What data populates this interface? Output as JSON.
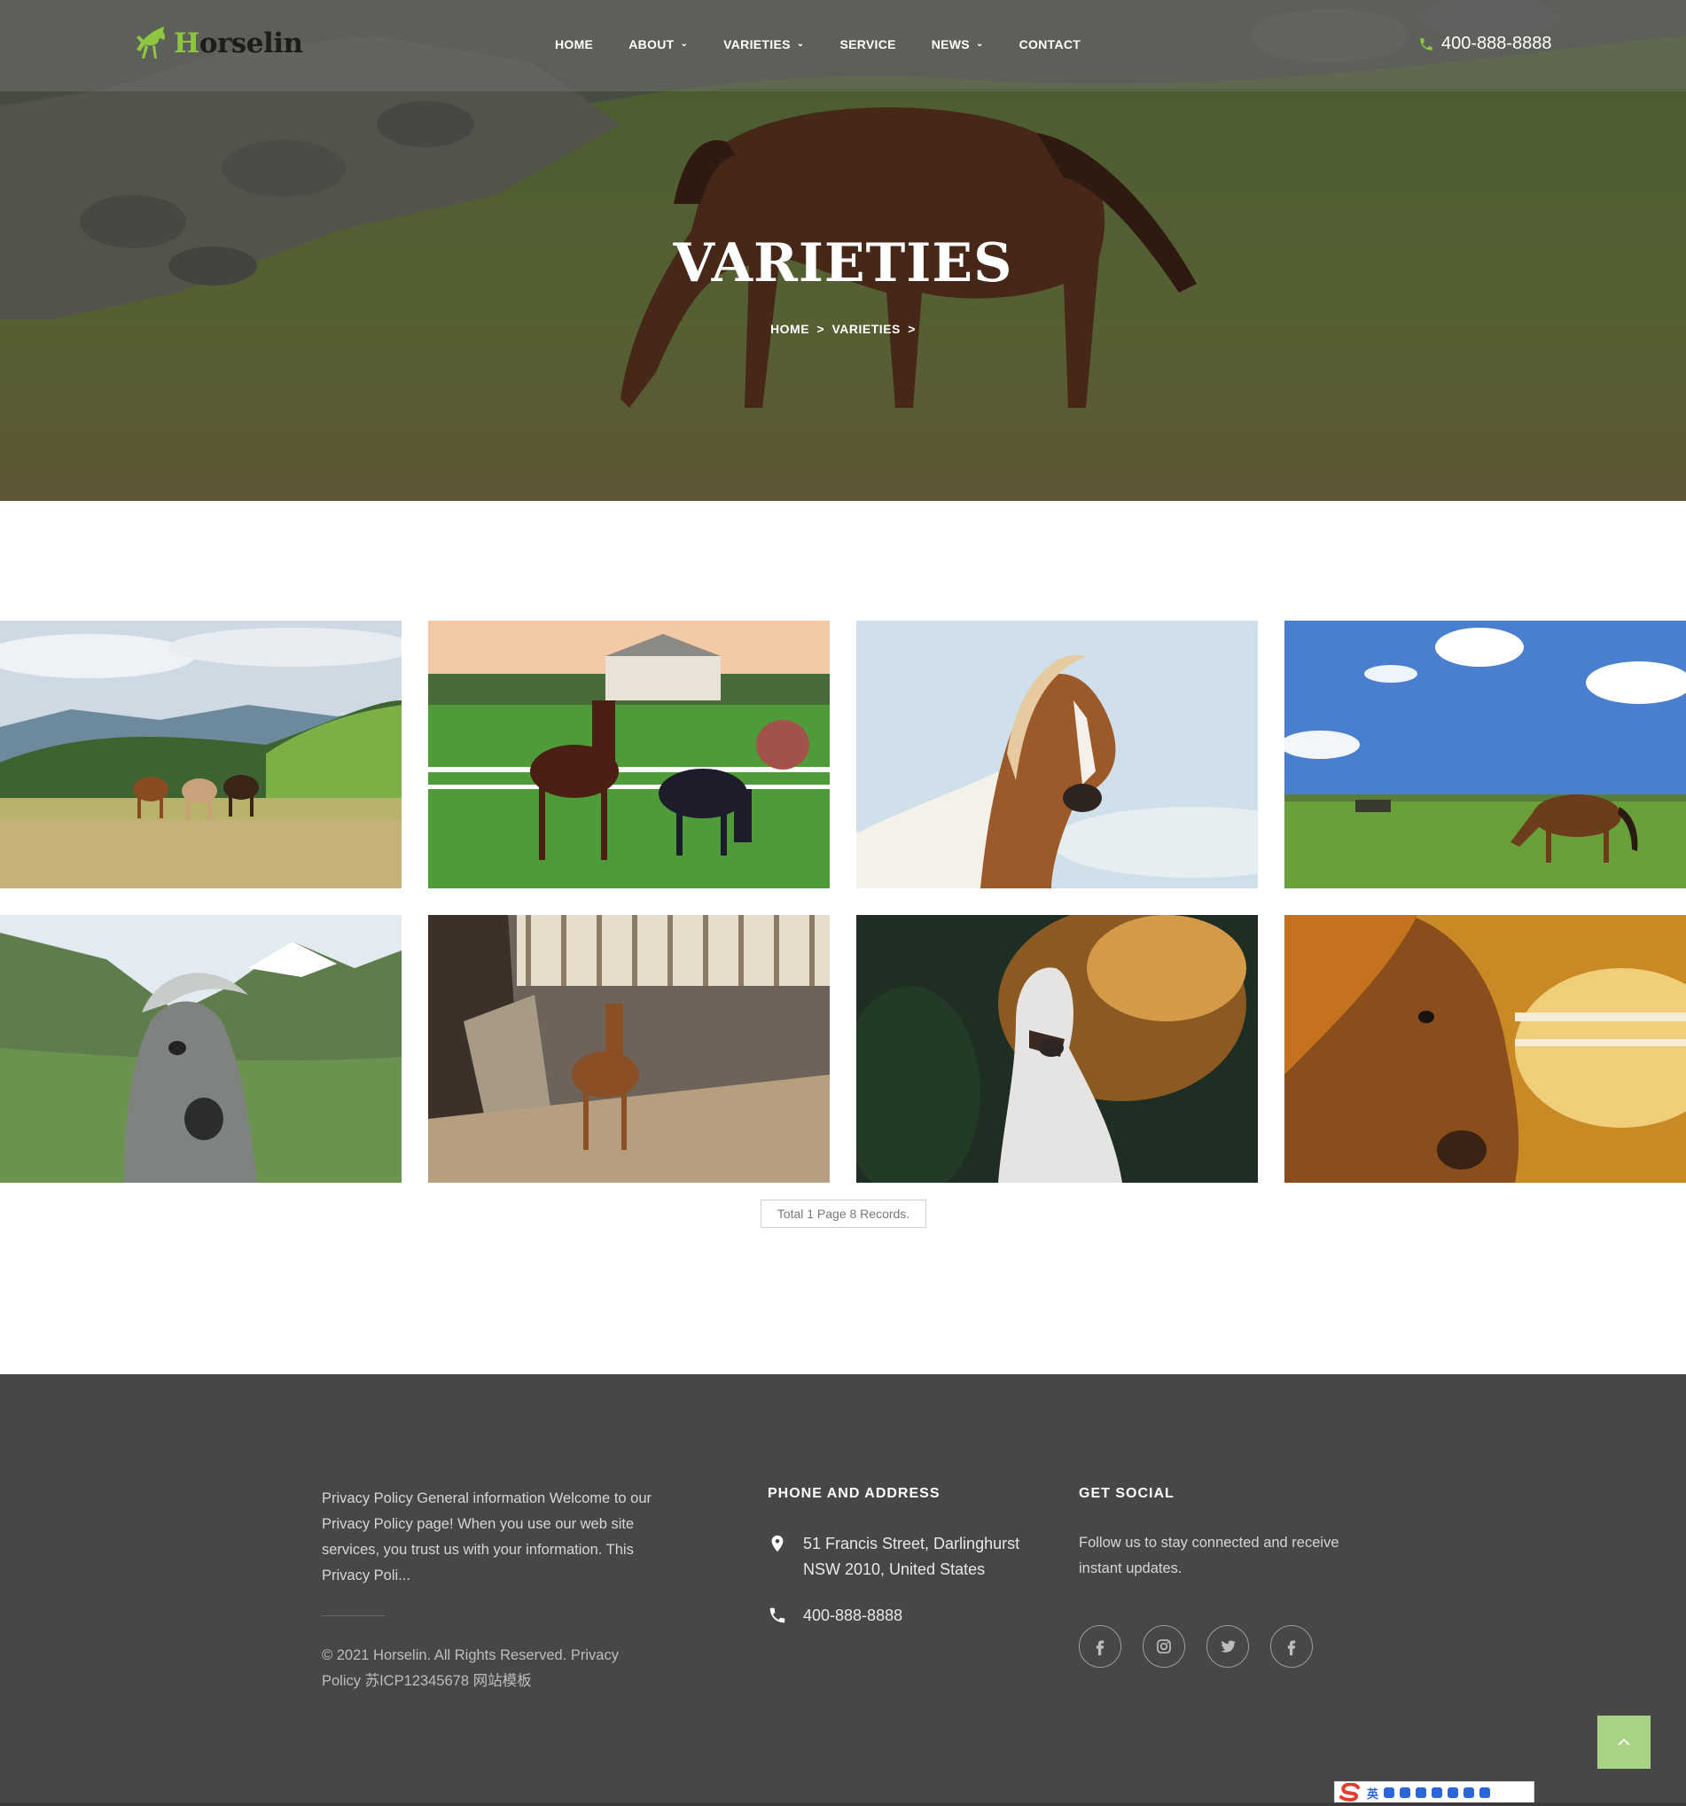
{
  "brand": {
    "name_first_letter": "H",
    "name_rest": "orselin",
    "accent": "#8ec63f"
  },
  "nav": {
    "items": [
      {
        "label": "HOME",
        "dropdown": false
      },
      {
        "label": "ABOUT",
        "dropdown": true
      },
      {
        "label": "VARIETIES",
        "dropdown": true
      },
      {
        "label": "SERVICE",
        "dropdown": false
      },
      {
        "label": "NEWS",
        "dropdown": true
      },
      {
        "label": "CONTACT",
        "dropdown": false
      }
    ],
    "phone": "400-888-8888",
    "icons": {
      "phone": "phone-icon",
      "dropdown": "chevron-down-icon"
    }
  },
  "hero": {
    "title": "VARIETIES",
    "breadcrumb": [
      "HOME",
      ">",
      "VARIETIES",
      ">"
    ]
  },
  "gallery": {
    "images": [
      "horses-in-mountain-meadow",
      "horses-on-ranch-pasture",
      "pinto-horse-portrait-sky",
      "horse-grazing-open-field",
      "grey-pony-in-mountains",
      "horse-in-stable-arena",
      "white-horse-in-forest",
      "golden-horse-portrait-sunset"
    ]
  },
  "pagination": {
    "text": "Total 1 Page 8 Records."
  },
  "footer": {
    "privacy": "Privacy Policy General information Welcome to our Privacy Policy page! When you use our web site services, you trust us with your information. This Privacy Poli...",
    "copyright": "© 2021 Horselin. All Rights Reserved. Privacy Policy 苏ICP12345678 网站模板",
    "phone_address": {
      "heading": "PHONE AND ADDRESS",
      "address": "51 Francis Street, Darlinghurst NSW 2010, United States",
      "phone": "400-888-8888"
    },
    "social": {
      "heading": "GET SOCIAL",
      "text": "Follow us to stay connected and receive instant updates.",
      "icons": [
        "facebook-icon",
        "instagram-icon",
        "twitter-icon",
        "facebook-icon"
      ]
    },
    "back_to_top_icon": "chevron-up-icon",
    "background": "#474747"
  },
  "ime_bar": {
    "label": "英"
  }
}
